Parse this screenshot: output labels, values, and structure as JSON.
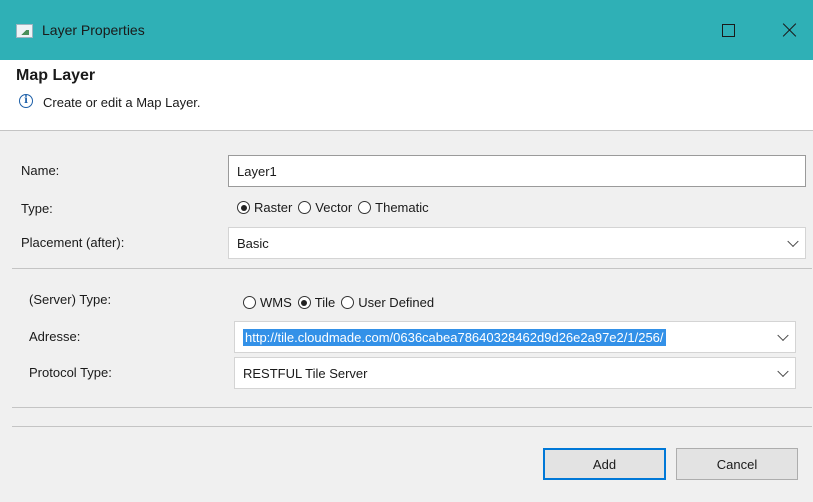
{
  "window": {
    "title": "Layer Properties",
    "icon": "layer-icon"
  },
  "header": {
    "title": "Map Layer",
    "description": "Create or edit a Map Layer.",
    "icon": "info-icon"
  },
  "form": {
    "name_label": "Name:",
    "name_value": "Layer1",
    "type_label": "Type:",
    "type_options": [
      "Raster",
      "Vector",
      "Thematic"
    ],
    "type_selected": "Raster",
    "placement_label": "Placement (after):",
    "placement_value": "Basic"
  },
  "server": {
    "type_label": "(Server) Type:",
    "type_options": [
      "WMS",
      "Tile",
      "User Defined"
    ],
    "type_selected": "Tile",
    "address_label": "Adresse:",
    "address_value": "http://tile.cloudmade.com/0636cabea78640328462d9d26e2a97e2/1/256/",
    "protocol_label": "Protocol Type:",
    "protocol_value": "RESTFUL Tile Server"
  },
  "buttons": {
    "add": "Add",
    "cancel": "Cancel"
  },
  "colors": {
    "titlebar": "#2fb0b6",
    "selection": "#3391e8",
    "default_button_border": "#0078d7"
  }
}
